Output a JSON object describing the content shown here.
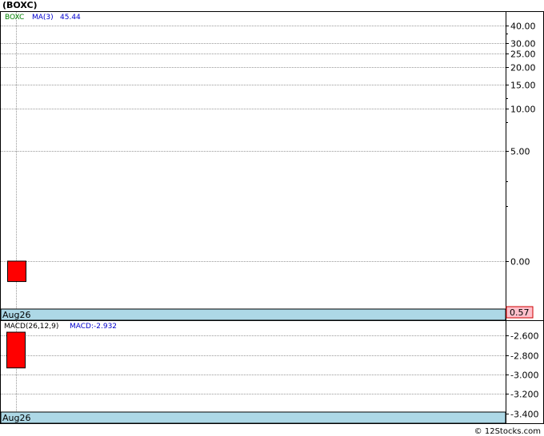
{
  "page": {
    "title": "(BOXC)",
    "footer": "© 12Stocks.com"
  },
  "price_panel": {
    "legend_symbol": "BOXC",
    "legend_ma": "MA(3)",
    "legend_ma_value": "45.44",
    "date_label": "Aug26",
    "last_price_badge": "0.57",
    "symbol_color": "#008000",
    "ma_color": "#0000cc"
  },
  "macd_panel": {
    "legend_params": "MACD(26,12,9)",
    "legend_value": "MACD:-2.932",
    "date_label": "Aug26",
    "value_color": "#0000cc"
  },
  "colors": {
    "candle_down": "#ff0000",
    "date_strip": "#add8e6",
    "badge_bg": "#ffc0cb",
    "grid": "#999999"
  },
  "chart_data": [
    {
      "type": "candlestick",
      "name": "price",
      "y_scale": "log",
      "ylim": [
        0.3,
        50
      ],
      "y_ticks": [
        {
          "value": 40,
          "label": "40.00"
        },
        {
          "value": 30,
          "label": "30.00"
        },
        {
          "value": 25,
          "label": "25.00"
        },
        {
          "value": 20,
          "label": "20.00"
        },
        {
          "value": 15,
          "label": "15.00"
        },
        {
          "value": 10,
          "label": "10.00"
        },
        {
          "value": 5,
          "label": "5.00"
        },
        {
          "value": 0.8,
          "label": "0.00"
        }
      ],
      "x_labels": [
        "Aug26"
      ],
      "candles": [
        {
          "date": "Aug26",
          "open": 0.8,
          "close": 0.57,
          "high": 0.8,
          "low": 0.57
        }
      ],
      "grid": true
    },
    {
      "type": "bar",
      "name": "macd",
      "ylim": [
        -3.5,
        -2.45
      ],
      "y_ticks": [
        {
          "value": -2.6,
          "label": "-2.600"
        },
        {
          "value": -2.8,
          "label": "-2.800"
        },
        {
          "value": -3.0,
          "label": "-3.000"
        },
        {
          "value": -3.2,
          "label": "-3.200"
        },
        {
          "value": -3.4,
          "label": "-3.400"
        }
      ],
      "x_labels": [
        "Aug26"
      ],
      "bars": [
        {
          "date": "Aug26",
          "top": -2.45,
          "bottom": -2.932
        }
      ],
      "grid": true
    }
  ]
}
